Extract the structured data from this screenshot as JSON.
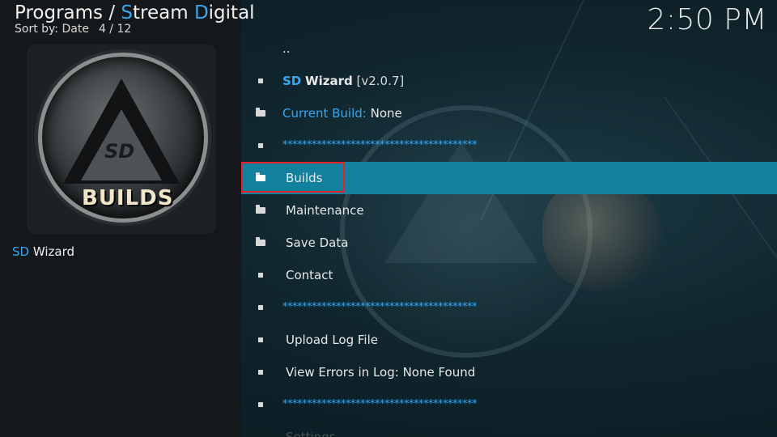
{
  "header": {
    "section": "Programs",
    "separator": "/",
    "addon_title_parts": [
      {
        "text": "S",
        "accent": true
      },
      {
        "text": "tream ",
        "accent": false
      },
      {
        "text": "D",
        "accent": true
      },
      {
        "text": "igital",
        "accent": false
      }
    ],
    "sort_label": "Sort by: Date",
    "position": "4 / 12"
  },
  "clock": "2:50 PM",
  "thumbnail": {
    "monogram": "SD",
    "caption": "BUILDS"
  },
  "addon": {
    "name_accent": "SD",
    "name_rest": "Wizard"
  },
  "list": {
    "parent": "..",
    "wizard": {
      "accent": "SD",
      "name": "Wizard",
      "version": "[v2.0.7]"
    },
    "current_build": {
      "label": "Current Build:",
      "value": "None"
    },
    "divider": "****************************************",
    "builds": "Builds",
    "maintenance": "Maintenance",
    "save_data": "Save Data",
    "contact": "Contact",
    "upload_log": "Upload Log File",
    "view_errors": "View Errors in Log: None Found",
    "settings": "Settings"
  },
  "colors": {
    "accent": "#3aa6f0",
    "focus": "#12819e",
    "outline": "#e8202c"
  },
  "icons": {
    "bullet": "bullet-icon",
    "folder": "folder-icon"
  }
}
